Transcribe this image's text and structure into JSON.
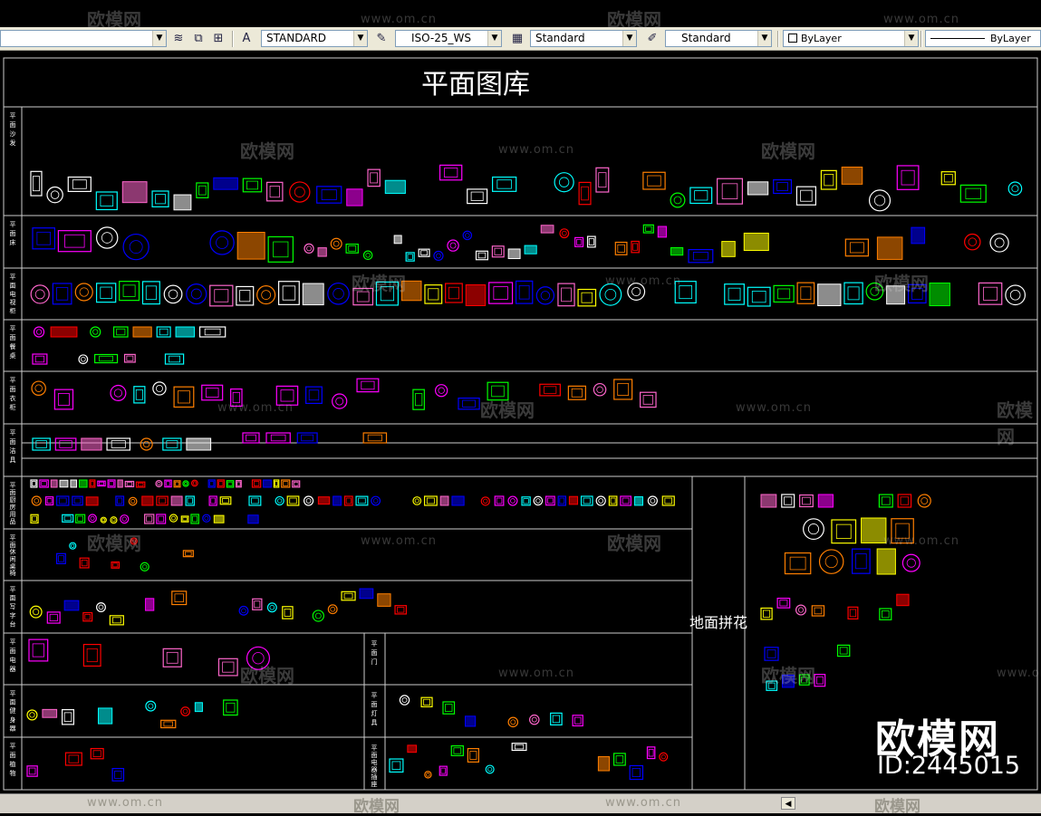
{
  "toolbar": {
    "text_style": "STANDARD",
    "dim_style": "ISO-25_WS",
    "table_style": "Standard",
    "multileader_style": "Standard",
    "layer_color": "ByLayer",
    "linetype": "ByLayer"
  },
  "drawing": {
    "title": "平面图库",
    "side_block_label": "地面拼花",
    "row_labels": [
      "平面沙发",
      "平面床",
      "平面电视柜",
      "平面餐桌",
      "平面衣柜",
      "平面洁具",
      "平面厨房用品",
      "平面休闲桌椅",
      "平面写字台",
      "平面电器",
      "平面健身器",
      "平面植物"
    ],
    "sub_labels": [
      "平面门",
      "平面灯具",
      "平面电器插座"
    ],
    "colors": [
      "#ff00ff",
      "#00ffff",
      "#ffff00",
      "#00ff00",
      "#ff0000",
      "#0000ff",
      "#ffffff",
      "#ff7f00",
      "#ff66cc"
    ]
  },
  "watermarks": {
    "url": "www.om.cn",
    "logo": "欧模网"
  },
  "stamp": {
    "brand": "欧模网",
    "id": "ID:2445015"
  }
}
